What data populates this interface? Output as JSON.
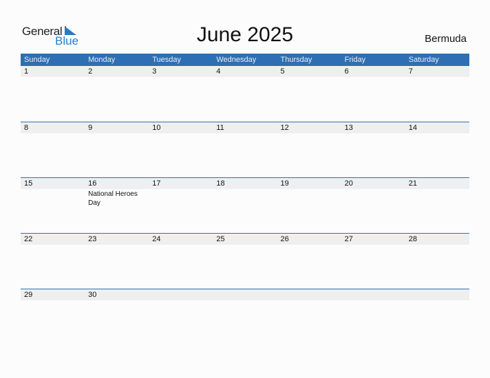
{
  "logo": {
    "part1": "General",
    "part2": "Blue"
  },
  "title": "June 2025",
  "country": "Bermuda",
  "colors": {
    "header_bg": "#2e6fb3",
    "row_bg": "#efefef",
    "brand_blue": "#2a7bc4"
  },
  "weekdays": [
    "Sunday",
    "Monday",
    "Tuesday",
    "Wednesday",
    "Thursday",
    "Friday",
    "Saturday"
  ],
  "weeks": [
    {
      "days": [
        "1",
        "2",
        "3",
        "4",
        "5",
        "6",
        "7"
      ],
      "events": [
        "",
        "",
        "",
        "",
        "",
        "",
        ""
      ]
    },
    {
      "days": [
        "8",
        "9",
        "10",
        "11",
        "12",
        "13",
        "14"
      ],
      "events": [
        "",
        "",
        "",
        "",
        "",
        "",
        ""
      ]
    },
    {
      "days": [
        "15",
        "16",
        "17",
        "18",
        "19",
        "20",
        "21"
      ],
      "events": [
        "",
        "National Heroes Day",
        "",
        "",
        "",
        "",
        ""
      ]
    },
    {
      "days": [
        "22",
        "23",
        "24",
        "25",
        "26",
        "27",
        "28"
      ],
      "events": [
        "",
        "",
        "",
        "",
        "",
        "",
        ""
      ]
    },
    {
      "days": [
        "29",
        "30",
        "",
        "",
        "",
        "",
        ""
      ],
      "events": [
        "",
        "",
        "",
        "",
        "",
        "",
        ""
      ]
    }
  ]
}
